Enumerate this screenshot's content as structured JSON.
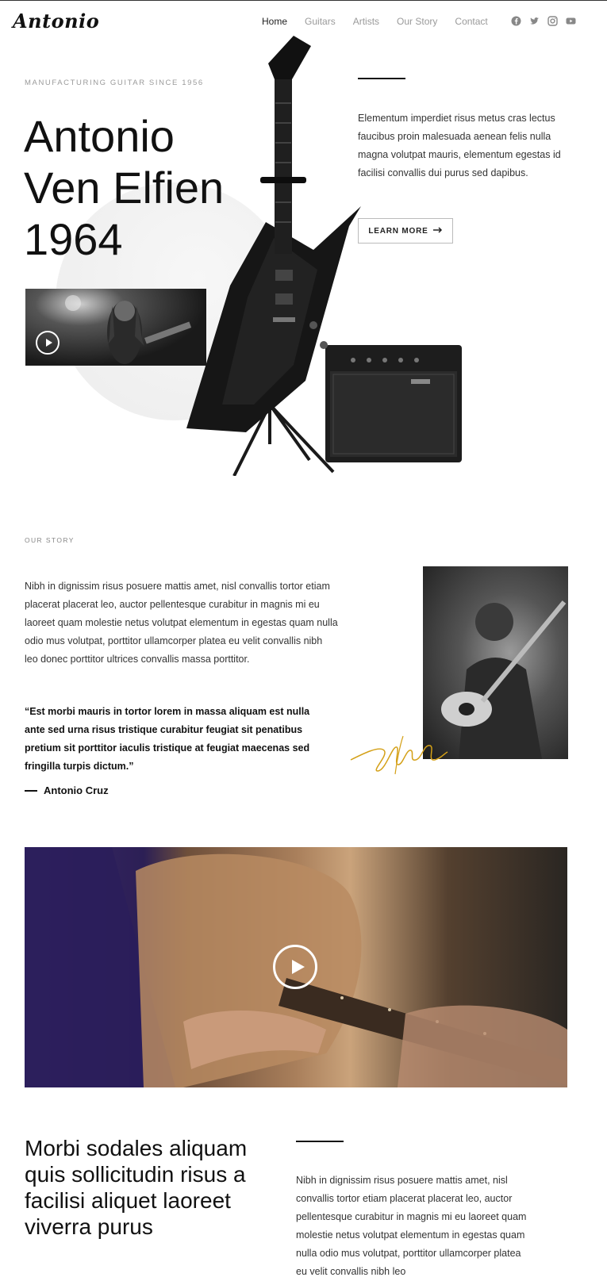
{
  "brand": {
    "logo": "Antonio"
  },
  "nav": {
    "items": [
      {
        "label": "Home",
        "active": true
      },
      {
        "label": "Guitars",
        "active": false
      },
      {
        "label": "Artists",
        "active": false
      },
      {
        "label": "Our Story",
        "active": false
      },
      {
        "label": "Contact",
        "active": false
      }
    ],
    "social_icons": [
      "facebook-icon",
      "twitter-icon",
      "instagram-icon",
      "youtube-icon"
    ]
  },
  "hero": {
    "kicker": "MANUFACTURING GUITAR SINCE 1956",
    "title_lines": [
      "Antonio",
      "Ven Elfien",
      "1964"
    ],
    "description": "Elementum imperdiet risus metus cras lectus faucibus proin malesuada aenean felis nulla magna volutpat mauris, elementum egestas id facilisi convallis dui purus sed dapibus.",
    "button_label": "LEARN MORE"
  },
  "story": {
    "kicker": "OUR STORY",
    "text": "Nibh in dignissim risus posuere mattis amet, nisl convallis tortor etiam placerat placerat leo, auctor pellentesque curabitur in magnis mi eu laoreet quam molestie netus volutpat elementum in egestas quam nulla odio mus volutpat, porttitor ullamcorper platea eu velit convallis nibh leo donec porttitor ultrices convallis massa porttitor.",
    "quote": "“Est morbi mauris in tortor lorem in massa aliquam est nulla ante sed urna risus tristique curabitur feugiat sit penatibus pretium sit porttitor iaculis tristique at feugiat maecenas sed fringilla turpis dictum.”",
    "author": "Antonio Cruz"
  },
  "feature": {
    "title": "Morbi sodales aliquam quis sollicitudin risus a facilisi aliquet laoreet viverra purus",
    "text": "Nibh in dignissim risus posuere mattis amet, nisl convallis tortor etiam placerat placerat leo, auctor pellentesque curabitur in magnis mi eu laoreet quam molestie netus volutpat elementum in egestas quam nulla odio mus volutpat, porttitor ullamcorper platea eu velit convallis nibh leo"
  },
  "colors": {
    "accent_gold": "#d4a017",
    "text_dark": "#111111",
    "muted": "#9a9a9a"
  }
}
